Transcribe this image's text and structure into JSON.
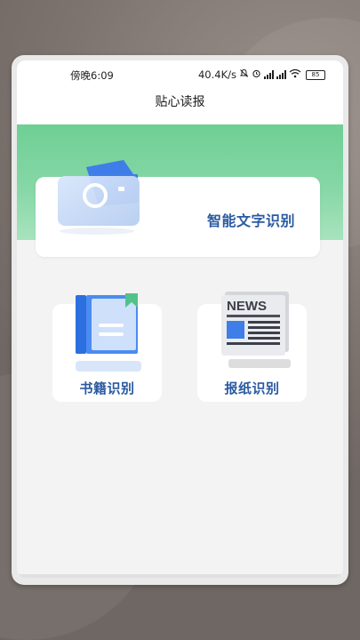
{
  "status_bar": {
    "time": "傍晚6:09",
    "network_speed": "40.4K/s",
    "battery_level": "85",
    "icons": [
      "bell-off-icon",
      "alarm-icon",
      "hd-signal-icon",
      "hd-signal-icon",
      "wifi-icon",
      "battery-icon"
    ]
  },
  "header": {
    "title": "贴心读报"
  },
  "hero": {
    "label": "智能文字识别",
    "icon": "camera-icon"
  },
  "tiles": [
    {
      "label": "书籍识别",
      "icon": "book-icon"
    },
    {
      "label": "报纸识别",
      "icon": "newspaper-icon",
      "icon_text": "NEWS"
    }
  ],
  "colors": {
    "accent_green": "#6fcf94",
    "label_blue": "#2b5aa0",
    "icon_blue": "#3f7de8"
  }
}
